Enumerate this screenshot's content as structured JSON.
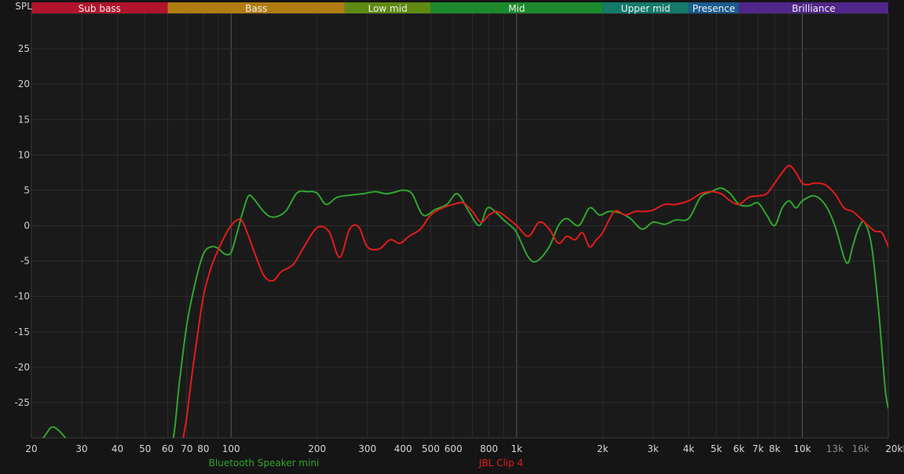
{
  "chart_data": {
    "type": "line",
    "ylabel": "SPL",
    "xlabel": "",
    "title": "",
    "xscale": "log",
    "xlim": [
      20,
      20000
    ],
    "ylim": [
      -30,
      30
    ],
    "grid": true,
    "legend_placement": "bottom",
    "x_ticks": [
      {
        "value": 20,
        "label": "20"
      },
      {
        "value": 30,
        "label": "30"
      },
      {
        "value": 40,
        "label": "40"
      },
      {
        "value": 50,
        "label": "50"
      },
      {
        "value": 60,
        "label": "60"
      },
      {
        "value": 70,
        "label": "70"
      },
      {
        "value": 80,
        "label": "80"
      },
      {
        "value": 100,
        "label": "100"
      },
      {
        "value": 200,
        "label": "200"
      },
      {
        "value": 300,
        "label": "300"
      },
      {
        "value": 400,
        "label": "400"
      },
      {
        "value": 500,
        "label": "500"
      },
      {
        "value": 600,
        "label": "600"
      },
      {
        "value": 800,
        "label": "800"
      },
      {
        "value": 1000,
        "label": "1k"
      },
      {
        "value": 2000,
        "label": "2k"
      },
      {
        "value": 3000,
        "label": "3k"
      },
      {
        "value": 4000,
        "label": "4k"
      },
      {
        "value": 5000,
        "label": "5k"
      },
      {
        "value": 6000,
        "label": "6k"
      },
      {
        "value": 7000,
        "label": "7k"
      },
      {
        "value": 8000,
        "label": "8k"
      },
      {
        "value": 10000,
        "label": "10k"
      },
      {
        "value": 13000,
        "label": "13k"
      },
      {
        "value": 16000,
        "label": "16k"
      },
      {
        "value": 20000,
        "label": "20kHz"
      }
    ],
    "y_ticks": [
      25,
      20,
      15,
      10,
      5,
      0,
      -5,
      -10,
      -15,
      -20,
      -25
    ],
    "bands": [
      {
        "label": "Sub bass",
        "from": 20,
        "to": 60,
        "color": "#b0142c"
      },
      {
        "label": "Bass",
        "from": 60,
        "to": 250,
        "color": "#b07c10"
      },
      {
        "label": "Low mid",
        "from": 250,
        "to": 500,
        "color": "#5e8a12"
      },
      {
        "label": "Mid",
        "from": 500,
        "to": 2000,
        "color": "#1b8a2c"
      },
      {
        "label": "Upper mid",
        "from": 2000,
        "to": 4000,
        "color": "#137a6a"
      },
      {
        "label": "Presence",
        "from": 4000,
        "to": 6000,
        "color": "#1b5a90"
      },
      {
        "label": "Brilliance",
        "from": 6000,
        "to": 20000,
        "color": "#50268a"
      }
    ],
    "series": [
      {
        "name": "Bluetooth Speaker mini",
        "color": "#2fa52f",
        "x": [
          20,
          22,
          23.5,
          25,
          27,
          30,
          40,
          55,
          62,
          66,
          70,
          75,
          80,
          85,
          90,
          95,
          100,
          105,
          110,
          115,
          120,
          130,
          140,
          155,
          170,
          185,
          200,
          215,
          235,
          260,
          290,
          320,
          350,
          380,
          400,
          430,
          470,
          520,
          570,
          620,
          680,
          740,
          790,
          850,
          900,
          950,
          1000,
          1100,
          1180,
          1300,
          1400,
          1500,
          1650,
          1800,
          1950,
          2100,
          2300,
          2500,
          2750,
          3000,
          3300,
          3600,
          4000,
          4400,
          4800,
          5200,
          5600,
          6000,
          6500,
          7000,
          7500,
          8000,
          8500,
          9000,
          9500,
          10000,
          11000,
          12000,
          13000,
          14000,
          14500,
          15000,
          15700,
          16500,
          17500,
          18500,
          19500,
          20000
        ],
        "y": [
          -31.5,
          -30,
          -28.5,
          -29,
          -30.5,
          -32,
          -33,
          -33,
          -31,
          -22,
          -14,
          -8,
          -4,
          -3,
          -3.2,
          -4,
          -3.8,
          -1,
          2,
          4.2,
          3.8,
          2,
          1.2,
          2,
          4.6,
          4.8,
          4.6,
          3,
          4,
          4.3,
          4.5,
          4.8,
          4.5,
          4.8,
          5,
          4.5,
          1.5,
          2.3,
          3,
          4.5,
          2,
          0,
          2.5,
          1.8,
          0.8,
          0,
          -1,
          -4.5,
          -5,
          -3,
          0,
          1,
          0,
          2.5,
          1.5,
          2,
          1.8,
          1,
          -0.5,
          0.5,
          0.2,
          0.8,
          1,
          4,
          4.8,
          5.3,
          4.5,
          3,
          2.8,
          3.2,
          1.5,
          0,
          2.5,
          3.5,
          2.5,
          3.5,
          4.2,
          3,
          0,
          -4.5,
          -5.2,
          -3,
          -0.5,
          0.5,
          -3,
          -12,
          -23,
          -25.8
        ]
      },
      {
        "name": "JBL Clip 4",
        "color": "#e31b1b",
        "x": [
          68,
          70,
          73,
          76,
          80,
          85,
          90,
          95,
          100,
          105,
          110,
          120,
          130,
          140,
          150,
          165,
          180,
          200,
          220,
          240,
          260,
          280,
          300,
          330,
          360,
          390,
          420,
          460,
          500,
          550,
          600,
          650,
          700,
          750,
          800,
          850,
          900,
          1000,
          1100,
          1200,
          1300,
          1400,
          1500,
          1600,
          1700,
          1800,
          1900,
          2000,
          2200,
          2400,
          2600,
          2800,
          3000,
          3300,
          3600,
          4000,
          4400,
          4800,
          5200,
          5600,
          6000,
          6500,
          7000,
          7500,
          8000,
          8500,
          9000,
          9500,
          10000,
          10500,
          11000,
          12000,
          13000,
          14000,
          15000,
          16000,
          17000,
          18000,
          19000,
          20000
        ],
        "y": [
          -30,
          -27,
          -21,
          -16,
          -10,
          -6,
          -3.5,
          -1.5,
          0,
          0.8,
          0.5,
          -3.5,
          -7,
          -7.8,
          -6.5,
          -5.5,
          -3,
          -0.3,
          -0.8,
          -4.5,
          -0.5,
          -0.2,
          -3,
          -3.3,
          -2,
          -2.5,
          -1.5,
          -0.5,
          1.5,
          2.5,
          3,
          3.2,
          2,
          0.5,
          1.5,
          2,
          1.5,
          0,
          -1.5,
          0.5,
          -0.5,
          -2.5,
          -1.5,
          -2,
          -1,
          -3,
          -2,
          -1,
          2,
          1.5,
          2,
          2,
          2.2,
          3,
          3,
          3.5,
          4.5,
          4.8,
          4.5,
          3.5,
          3,
          4,
          4.2,
          4.5,
          6,
          7.5,
          8.5,
          7.5,
          6,
          5.8,
          6,
          5.8,
          4.5,
          2.5,
          2,
          1,
          0,
          -0.8,
          -1,
          -3
        ]
      }
    ]
  }
}
